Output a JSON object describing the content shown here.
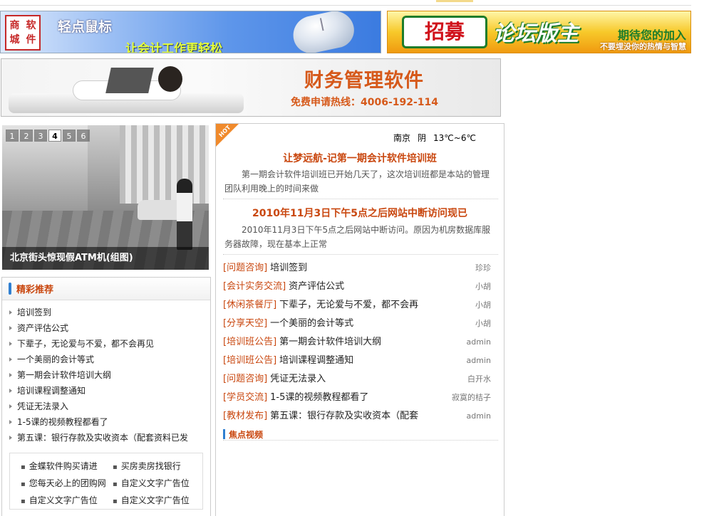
{
  "banner1": {
    "stamp": [
      "商",
      "软",
      "城",
      "件"
    ],
    "line1": "轻点鼠标",
    "line2": "让会计工作更轻松"
  },
  "banner2": {
    "recruit": "招募",
    "forum_owner": "论坛版主",
    "tagline": "期待您的加入",
    "sub": "不要埋没你的热情与智慧"
  },
  "banner3": {
    "title": "财务管理软件",
    "hotline": "免费申请热线：4006-192-114"
  },
  "slideshow": {
    "tabs": [
      "1",
      "2",
      "3",
      "4",
      "5",
      "6"
    ],
    "active_tab": "4",
    "caption": "北京街头惊现假ATM机(组图)"
  },
  "recommend": {
    "title": "精彩推荐",
    "items": [
      "培训签到",
      "资产评估公式",
      "下辈子，无论爱与不爱，都不会再见",
      "一个美丽的会计等式",
      "第一期会计软件培训大纲",
      "培训课程调整通知",
      "凭证无法录入",
      "1-5课的视频教程都看了",
      "第五课：银行存款及实收资本（配套资料已发"
    ]
  },
  "links": [
    "金蝶软件购买请进",
    "买房卖房找银行",
    "您每天必上的团购网",
    "自定义文字广告位",
    "自定义文字广告位",
    "自定义文字广告位"
  ],
  "content": {
    "hot": "HOT",
    "weather": {
      "city": "南京",
      "condition": "阴",
      "temp": "13℃~6℃"
    },
    "news": [
      {
        "title": "让梦远航-记第一期会计软件培训班",
        "summary": "第一期会计软件培训班已开始几天了，这次培训班都是本站的管理团队利用晚上的时间来做"
      },
      {
        "title": "2010年11月3日下午5点之后网站中断访问现已",
        "summary": "2010年11月3日下午5点之后网站中断访问。原因为机房数据库服务器故障，现在基本上正常"
      }
    ],
    "forum": [
      {
        "cat": "[问题咨询]",
        "title": "培训签到",
        "author": "珍珍"
      },
      {
        "cat": "[会计实务交流]",
        "title": "资产评估公式",
        "author": "小胡"
      },
      {
        "cat": "[休闲茶餐厅]",
        "title": "下辈子，无论爱与不爱，都不会再",
        "author": "小胡"
      },
      {
        "cat": "[分享天空]",
        "title": "一个美丽的会计等式",
        "author": "小胡"
      },
      {
        "cat": "[培训班公告]",
        "title": "第一期会计软件培训大纲",
        "author": "admin"
      },
      {
        "cat": "[培训班公告]",
        "title": "培训课程调整通知",
        "author": "admin"
      },
      {
        "cat": "[问题咨询]",
        "title": "凭证无法录入",
        "author": "白开水"
      },
      {
        "cat": "[学员交流]",
        "title": "1-5课的视频教程都看了",
        "author": "寂寞的桔子"
      },
      {
        "cat": "[教材发布]",
        "title": "第五课：银行存款及实收资本（配套",
        "author": "admin"
      }
    ],
    "video_title": "焦点视频"
  }
}
